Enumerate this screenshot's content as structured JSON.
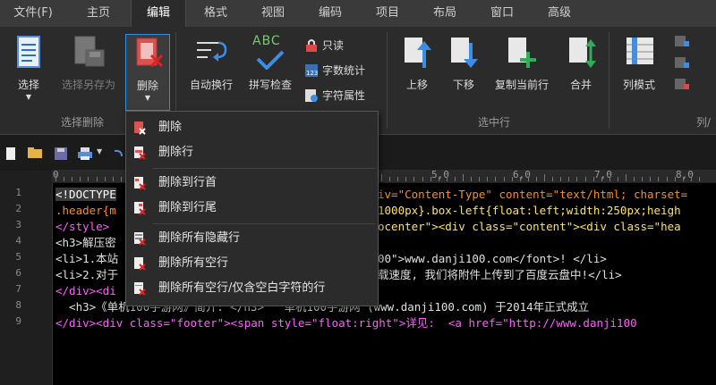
{
  "menubar": {
    "items": [
      "文件(F)",
      "主页",
      "编辑",
      "格式",
      "视图",
      "编码",
      "项目",
      "布局",
      "窗口",
      "高级"
    ],
    "active": "编辑"
  },
  "ribbon": {
    "groups": {
      "select_delete": "选择删除",
      "selected_rows": "选中行",
      "column_partial": "列/"
    },
    "buttons": {
      "select": "选择",
      "select_save_as": "选择另存为",
      "delete": "删除",
      "auto_wrap": "自动换行",
      "spell_check": "拼写检查",
      "spell_check_icon_text": "ABC",
      "read_only": "只读",
      "word_count": "字数统计",
      "char_props": "字符属性",
      "move_up": "上移",
      "move_down": "下移",
      "copy_current_line": "复制当前行",
      "merge": "合并",
      "column_mode": "列模式"
    }
  },
  "dropdown": {
    "items": [
      "删除",
      "删除行",
      "删除到行首",
      "删除到行尾",
      "删除所有隐藏行",
      "删除所有空行",
      "删除所有空行/仅含空白字符的行"
    ]
  },
  "ruler": {
    "labels": [
      "0",
      "5,0",
      "6,0",
      "7,0",
      "8,0"
    ]
  },
  "editor": {
    "line_numbers": [
      "1",
      "2",
      "3",
      "4",
      "5",
      "6",
      "7",
      "8",
      "9"
    ],
    "lines": {
      "l1a": "<!DOCTYPE",
      "l1b": "iv=\"Content-Type\" content=\"text/html; charset=",
      "l2a": ".header{m",
      "l2b": "1000px}.box-left{float:left;width:250px;heigh",
      "l3a": "</style>",
      "l3b": "ocenter\"><div class=\"content\"><div class=\"hea",
      "l4a": "<h3>解压密",
      "l5a": "<li>1.本站",
      "l5b": "00\">www.danji100.com</font>! </li>",
      "l6a": "<li>2.对于",
      "l6b": "载速度, 我们将附件上传到了百度云盘中!</li>",
      "l7a": "</div><di",
      "l8": "  <h3>《单机100手游网》简介: </h3>   单机100手游网 (www.danji100.com) 于2014年正式成立",
      "l9": "</div><div class=\"footer\"><span style=\"float:right\">详见:  <a href=\"http://www.danji100"
    }
  }
}
